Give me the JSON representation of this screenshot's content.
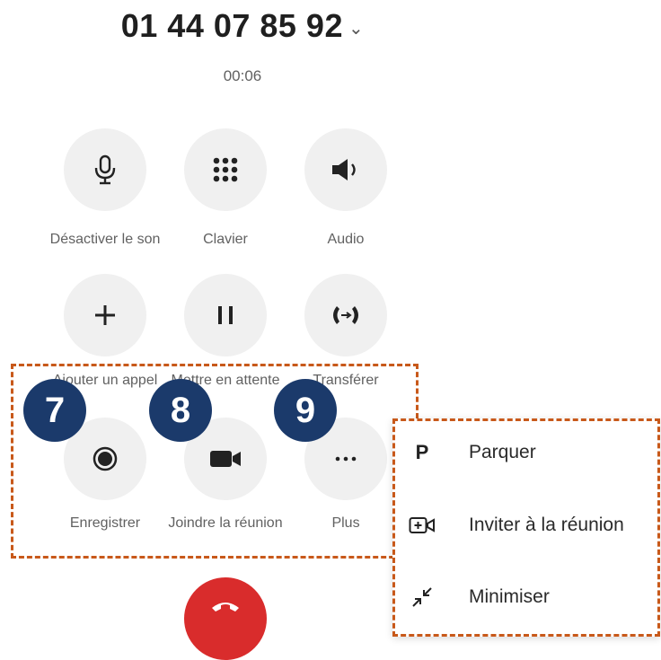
{
  "call": {
    "phone_number": "01 44 07 85 92",
    "chevron": "⌄",
    "duration": "00:06"
  },
  "controls": {
    "mute": {
      "label": "Désactiver le son",
      "icon": "microphone-icon"
    },
    "keypad": {
      "label": "Clavier",
      "icon": "dialpad-icon"
    },
    "audio": {
      "label": "Audio",
      "icon": "speaker-icon"
    },
    "add_call": {
      "label": "Ajouter un appel",
      "icon": "plus-icon"
    },
    "hold": {
      "label": "Mettre en attente",
      "icon": "pause-icon"
    },
    "transfer": {
      "label": "Transférer",
      "icon": "transfer-icon"
    },
    "record": {
      "label": "Enregistrer",
      "icon": "record-icon"
    },
    "join_meeting": {
      "label": "Joindre la réunion",
      "icon": "video-icon"
    },
    "more": {
      "label": "Plus",
      "icon": "more-icon"
    }
  },
  "badges": {
    "b7": "7",
    "b8": "8",
    "b9": "9"
  },
  "menu": {
    "items": [
      {
        "label": "Parquer",
        "icon": "park-icon",
        "glyph": "P"
      },
      {
        "label": "Inviter à la réunion",
        "icon": "video-add-icon"
      },
      {
        "label": "Minimiser",
        "icon": "minimize-icon"
      }
    ]
  },
  "hangup": {
    "icon": "hang-up-icon"
  },
  "colors": {
    "badge": "#1b3a6b",
    "dashed_outline": "#c8591a",
    "hangup": "#d92c2c",
    "button_bg": "#f0f0f0"
  }
}
